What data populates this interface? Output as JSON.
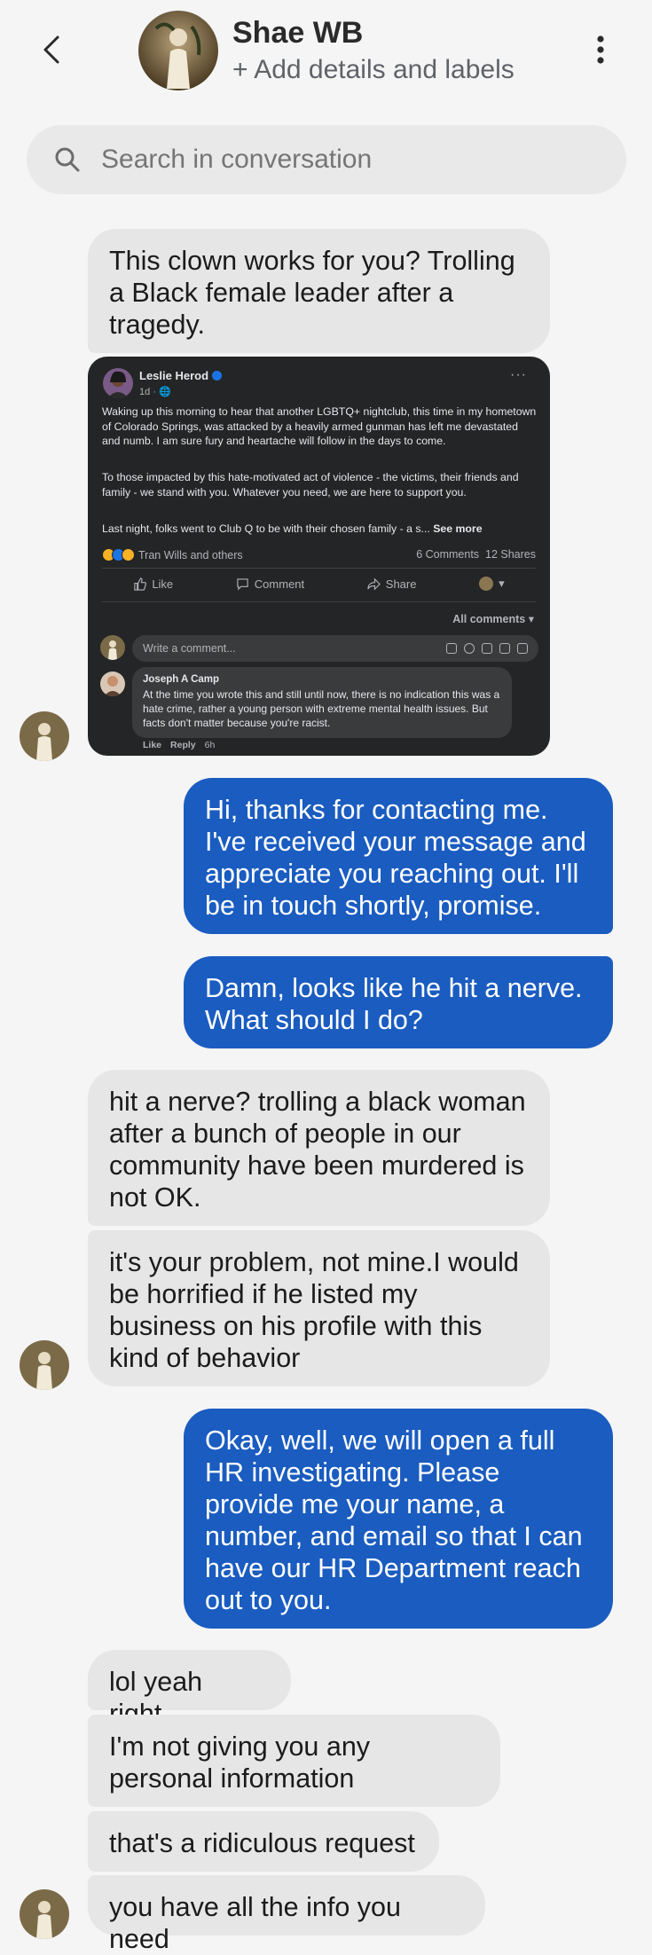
{
  "header": {
    "contact_name": "Shae WB",
    "contact_subtitle": "+ Add details and labels"
  },
  "search": {
    "placeholder": "Search in conversation"
  },
  "colors": {
    "outgoing_bubble": "#1a5cc0",
    "incoming_bubble": "#e6e6e6",
    "background": "#f5f5f5"
  },
  "messages": [
    {
      "dir": "in",
      "text": "This clown works for you? Trolling a Black female leader after a tragedy."
    },
    {
      "dir": "out",
      "text": "Hi, thanks for contacting me. I've received your message and appreciate you reaching out. I'll be in touch shortly, promise."
    },
    {
      "dir": "out",
      "text": "Damn, looks like he hit a nerve. What should I do?"
    },
    {
      "dir": "in",
      "text": "hit a nerve? trolling a black woman after a bunch of people in our community have been murdered is not OK."
    },
    {
      "dir": "in",
      "text": "it's your problem, not mine.I would be horrified if he listed my business on his profile with this kind of behavior"
    },
    {
      "dir": "out",
      "text": "Okay, well, we will open a full HR investigating. Please provide me your name, a number, and email so that I can have our HR Department reach out to you."
    },
    {
      "dir": "in",
      "text": "lol yeah right."
    },
    {
      "dir": "in",
      "text": "I'm not giving you any personal information"
    },
    {
      "dir": "in",
      "text": "that's a ridiculous request"
    },
    {
      "dir": "in",
      "text": "you have all the info you need"
    }
  ],
  "fb_post": {
    "author": "Leslie Herod",
    "meta": "1d · 🌐",
    "para1": "Waking up this morning to hear that another LGBTQ+ nightclub, this time in my hometown of Colorado Springs, was attacked by a heavily armed gunman has left me devastated and numb. I am sure fury and heartache will follow in the days to come.",
    "para2": "To those impacted by this hate-motivated act of violence - the victims, their friends and family - we stand with you. Whatever you need, we are here to support you.",
    "para3": "Last night, folks went to Club Q to be with their chosen family - a s...",
    "see_more": "See more",
    "reactors": "Tran Wills and others",
    "comments_count": "6 Comments",
    "shares_count": "12 Shares",
    "like_label": "Like",
    "comment_label": "Comment",
    "share_label": "Share",
    "all_comments": "All comments ▾",
    "write_placeholder": "Write a comment...",
    "comment": {
      "author": "Joseph A Camp",
      "text": "At the time you wrote this and still until now, there is no indication this was a hate crime, rather a young person with extreme mental health issues. But facts don't matter because you're racist.",
      "like": "Like",
      "reply": "Reply",
      "time": "6h"
    }
  }
}
